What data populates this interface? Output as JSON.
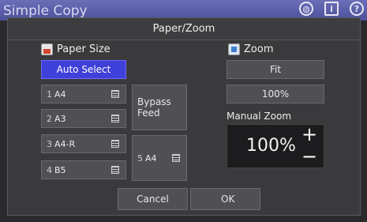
{
  "app": {
    "title": "Simple Copy",
    "icons": [
      "globe-icon",
      "info-icon",
      "help-icon"
    ]
  },
  "dialog": {
    "title": "Paper/Zoom",
    "paper_size": {
      "label": "Paper Size",
      "auto_select": "Auto Select",
      "trays": [
        {
          "number": "1",
          "size": "A4"
        },
        {
          "number": "2",
          "size": "A3"
        },
        {
          "number": "3",
          "size": "A4-R"
        },
        {
          "number": "4",
          "size": "B5"
        }
      ],
      "bypass_label": "Bypass Feed",
      "bypass_tray": {
        "number": "5",
        "size": "A4"
      }
    },
    "zoom": {
      "label": "Zoom",
      "fit": "Fit",
      "preset_100": "100%",
      "manual_label": "Manual Zoom",
      "manual_value": "100%",
      "plus": "+",
      "minus": "−"
    },
    "actions": {
      "cancel": "Cancel",
      "ok": "OK"
    }
  },
  "colors": {
    "selected": "#3f3fd9",
    "button": "#505054",
    "dialog_bg": "#3a3a3d"
  }
}
